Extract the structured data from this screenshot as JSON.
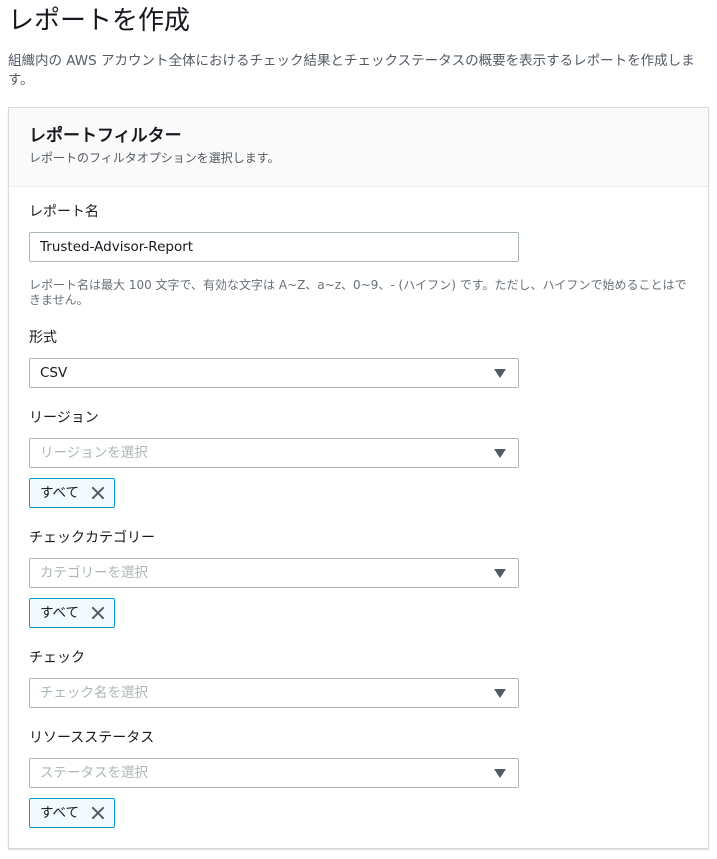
{
  "page": {
    "title": "レポートを作成",
    "description": "組織内の AWS アカウント全体におけるチェック結果とチェックステータスの概要を表示するレポートを作成します。"
  },
  "panel": {
    "title": "レポートフィルター",
    "subtitle": "レポートのフィルタオプションを選択します。"
  },
  "fields": {
    "report_name": {
      "label": "レポート名",
      "value": "Trusted-Advisor-Report",
      "constraint": "レポート名は最大 100 文字で、有効な文字は A~Z、a~z、0~9、- (ハイフン) です。ただし、ハイフンで始めることはできません。"
    },
    "format": {
      "label": "形式",
      "value": "CSV"
    },
    "region": {
      "label": "リージョン",
      "placeholder": "リージョンを選択",
      "token": "すべて"
    },
    "check_category": {
      "label": "チェックカテゴリー",
      "placeholder": "カテゴリーを選択",
      "token": "すべて"
    },
    "check": {
      "label": "チェック",
      "placeholder": "チェック名を選択"
    },
    "resource_status": {
      "label": "リソースステータス",
      "placeholder": "ステータスを選択",
      "token": "すべて"
    }
  },
  "colors": {
    "token_border": "#00a1c9",
    "input_border": "#aab7b8",
    "placeholder": "#aab7b8"
  }
}
